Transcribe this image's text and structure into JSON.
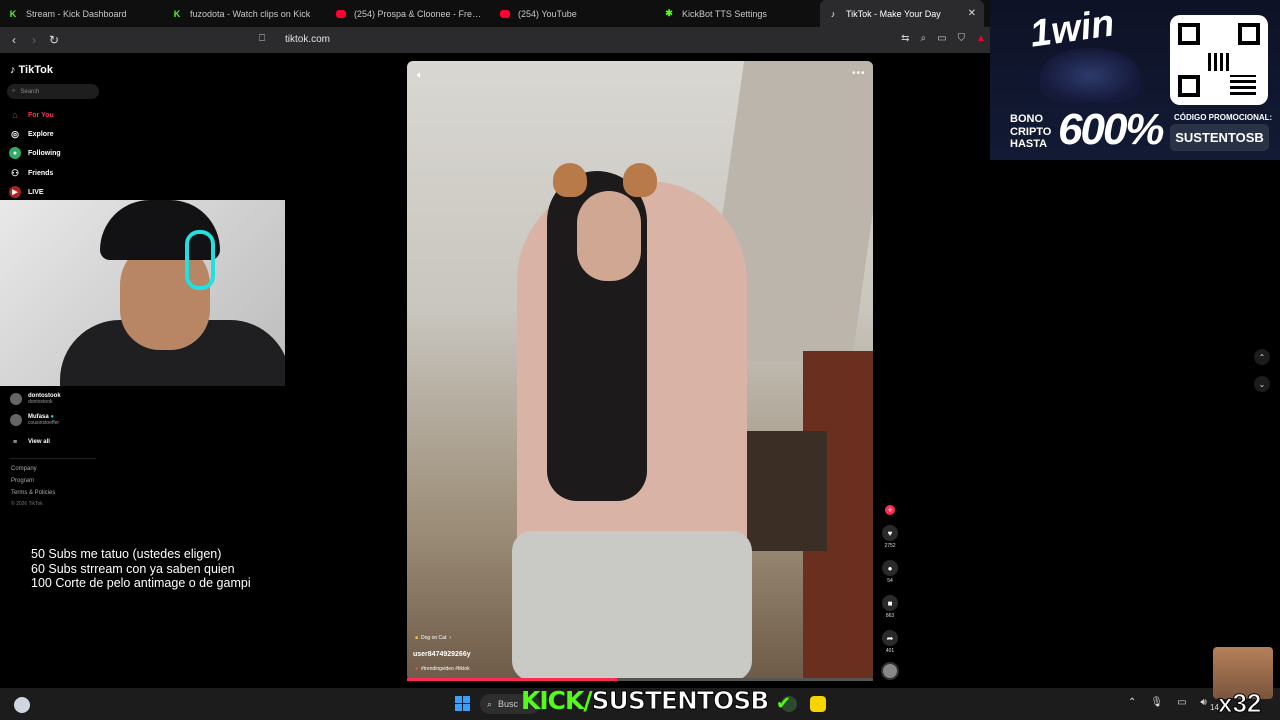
{
  "browser": {
    "tabs": [
      {
        "label": "Stream - Kick Dashboard",
        "icon": "kick-icon"
      },
      {
        "label": "fuzodota - Watch clips on Kick",
        "icon": "kick-icon"
      },
      {
        "label": "(254) Prospa & Cloonee - Free Your",
        "icon": "youtube-icon"
      },
      {
        "label": "(254) YouTube",
        "icon": "youtube-icon"
      },
      {
        "label": "KickBot TTS Settings",
        "icon": "kickbot-icon"
      },
      {
        "label": "TikTok - Make Your Day",
        "icon": "tiktok-icon",
        "active": true,
        "close": "✕"
      }
    ],
    "url": "tiktok.com"
  },
  "tiktok": {
    "logo": "TikTok",
    "search_placeholder": "Search",
    "nav": [
      {
        "label": "For You",
        "icon": "home-icon",
        "active": true
      },
      {
        "label": "Explore",
        "icon": "compass-icon"
      },
      {
        "label": "Following",
        "icon": "following-icon"
      },
      {
        "label": "Friends",
        "icon": "friends-icon"
      },
      {
        "label": "LIVE",
        "icon": "live-icon"
      }
    ],
    "following_accounts": [
      {
        "name": "dontostook",
        "handle": "dontostook"
      },
      {
        "name": "Mufasa",
        "handle": "cousinstoeffer"
      }
    ],
    "view_all": "View all",
    "footer": [
      "Company",
      "Program",
      "Terms & Policies",
      "© 2026 TikTok"
    ],
    "video": {
      "effect": "Dog on Cat",
      "username": "user8474929266y",
      "tags": "#trendingvideo #tiktok",
      "progress": 0.45
    },
    "actions": {
      "likes": "2752",
      "comments": "54",
      "saves": "863",
      "shares": "401"
    }
  },
  "stream_overlay": {
    "goals": [
      "50 Subs me tatuo (ustedes eligen)",
      "60 Subs strream con ya saben quien",
      "100 Corte de pelo antimage o de gampi"
    ],
    "ad": {
      "brand": "1win",
      "bono_lines": [
        "BONO",
        "CRIPTO",
        "HASTA"
      ],
      "percent": "600%",
      "code_label": "CÓDIGO PROMOCIONAL:",
      "code": "SUSTENTOSB"
    },
    "kick_banner": {
      "kick": "KICK/",
      "name": "SUSTENTOSB"
    },
    "sub_multiplier": "x32"
  },
  "taskbar": {
    "search_text": "Busc",
    "clock": "14"
  }
}
